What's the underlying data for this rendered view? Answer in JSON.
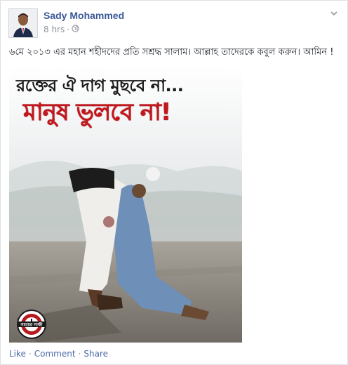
{
  "post": {
    "author": "Sady Mohammed",
    "time": "8 hrs",
    "separator": "·",
    "text": "৬মে ২০১৩ এর মহান শহীদদের প্রতি সশ্রদ্ধ সালাম। আল্লাহ তাদেরকে কবুল করুন। আমিন !",
    "photo": {
      "headline_top": "রক্তের ঐ দাগ মুছবে না...",
      "headline_main": "মানুষ ভুলবে না!",
      "logo_text": "সময়ের সাক্ষী"
    }
  },
  "actions": {
    "like": "Like",
    "comment": "Comment",
    "share": "Share",
    "dot": "·"
  },
  "colors": {
    "link": "#3b5998",
    "meta": "#90949c",
    "headline_red": "#c2171c"
  },
  "icons": {
    "audience": "globe-icon",
    "menu": "chevron-down-icon"
  }
}
